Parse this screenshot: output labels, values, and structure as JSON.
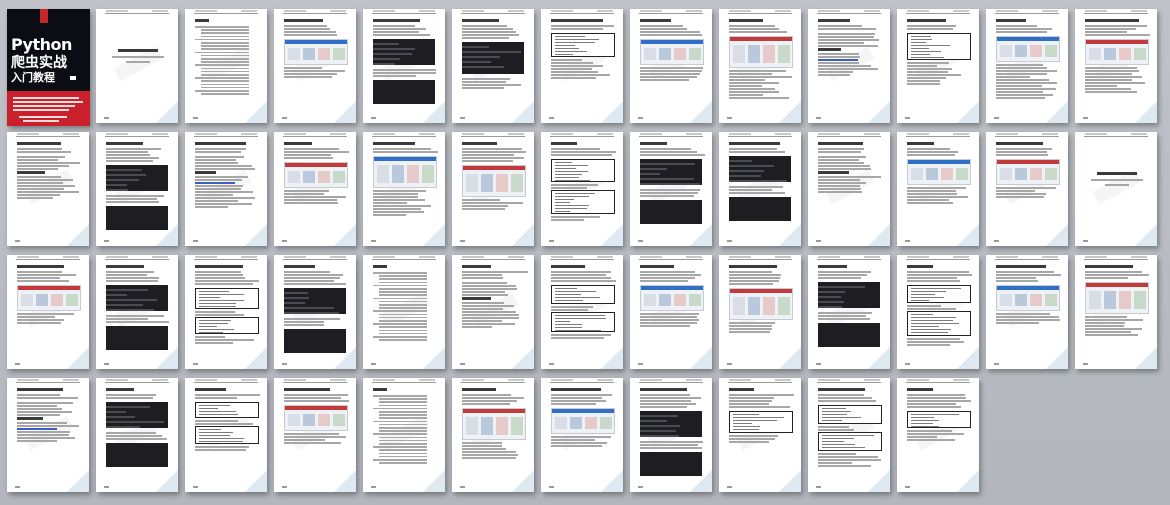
{
  "viewer": {
    "label": "Page thumbnail overview",
    "accent_color": "#c9202b"
  },
  "cover": {
    "title_line1": "Python",
    "title_line2": "爬虫实战",
    "title_line3": "入门教程"
  },
  "thumbnail_columns": 13,
  "thumbnail_rows": 4,
  "thumbnail_count": 50
}
